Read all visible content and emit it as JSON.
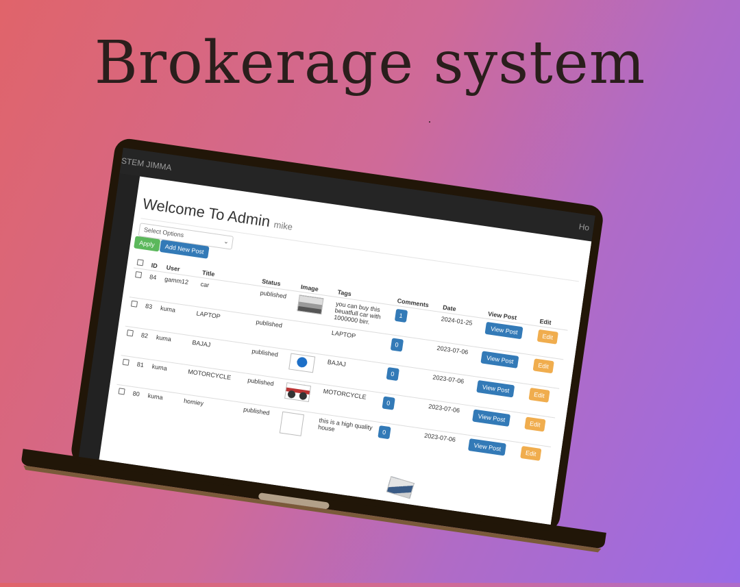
{
  "headline": "Brokerage system",
  "topbar": {
    "brand": "STEM JIMMA",
    "right": "Ho"
  },
  "page": {
    "title": "Welcome To Admin",
    "username": "mike"
  },
  "bulk": {
    "select_placeholder": "Select Options",
    "apply_label": "Apply",
    "add_new_label": "Add New Post"
  },
  "table": {
    "headers": [
      "ID",
      "User",
      "Title",
      "Status",
      "Image",
      "Tags",
      "Comments",
      "Date",
      "View Post",
      "Edit"
    ],
    "rows": [
      {
        "id": "84",
        "user": "gamm12",
        "title": "car",
        "status": "published",
        "image": "car",
        "tags": "you can buy this beuatfull car with 1000000 birr.",
        "comments": "1",
        "date": "2024-01-25",
        "view": "View Post",
        "edit": "Edit"
      },
      {
        "id": "83",
        "user": "kuma",
        "title": "LAPTOP",
        "status": "published",
        "image": "laptop",
        "tags": "LAPTOP",
        "comments": "0",
        "date": "2023-07-06",
        "view": "View Post",
        "edit": "Edit"
      },
      {
        "id": "82",
        "user": "kuma",
        "title": "BAJAJ",
        "status": "published",
        "image": "bajaj",
        "tags": "BAJAJ",
        "comments": "0",
        "date": "2023-07-06",
        "view": "View Post",
        "edit": "Edit"
      },
      {
        "id": "81",
        "user": "kuma",
        "title": "MOTORCYCLE",
        "status": "published",
        "image": "moto",
        "tags": "MOTORCYCLE",
        "comments": "0",
        "date": "2023-07-06",
        "view": "View Post",
        "edit": "Edit"
      },
      {
        "id": "80",
        "user": "kuma",
        "title": "homiey",
        "status": "published",
        "image": "blank",
        "tags": "this is a high quality house",
        "comments": "0",
        "date": "2023-07-06",
        "view": "View Post",
        "edit": "Edit"
      }
    ]
  }
}
